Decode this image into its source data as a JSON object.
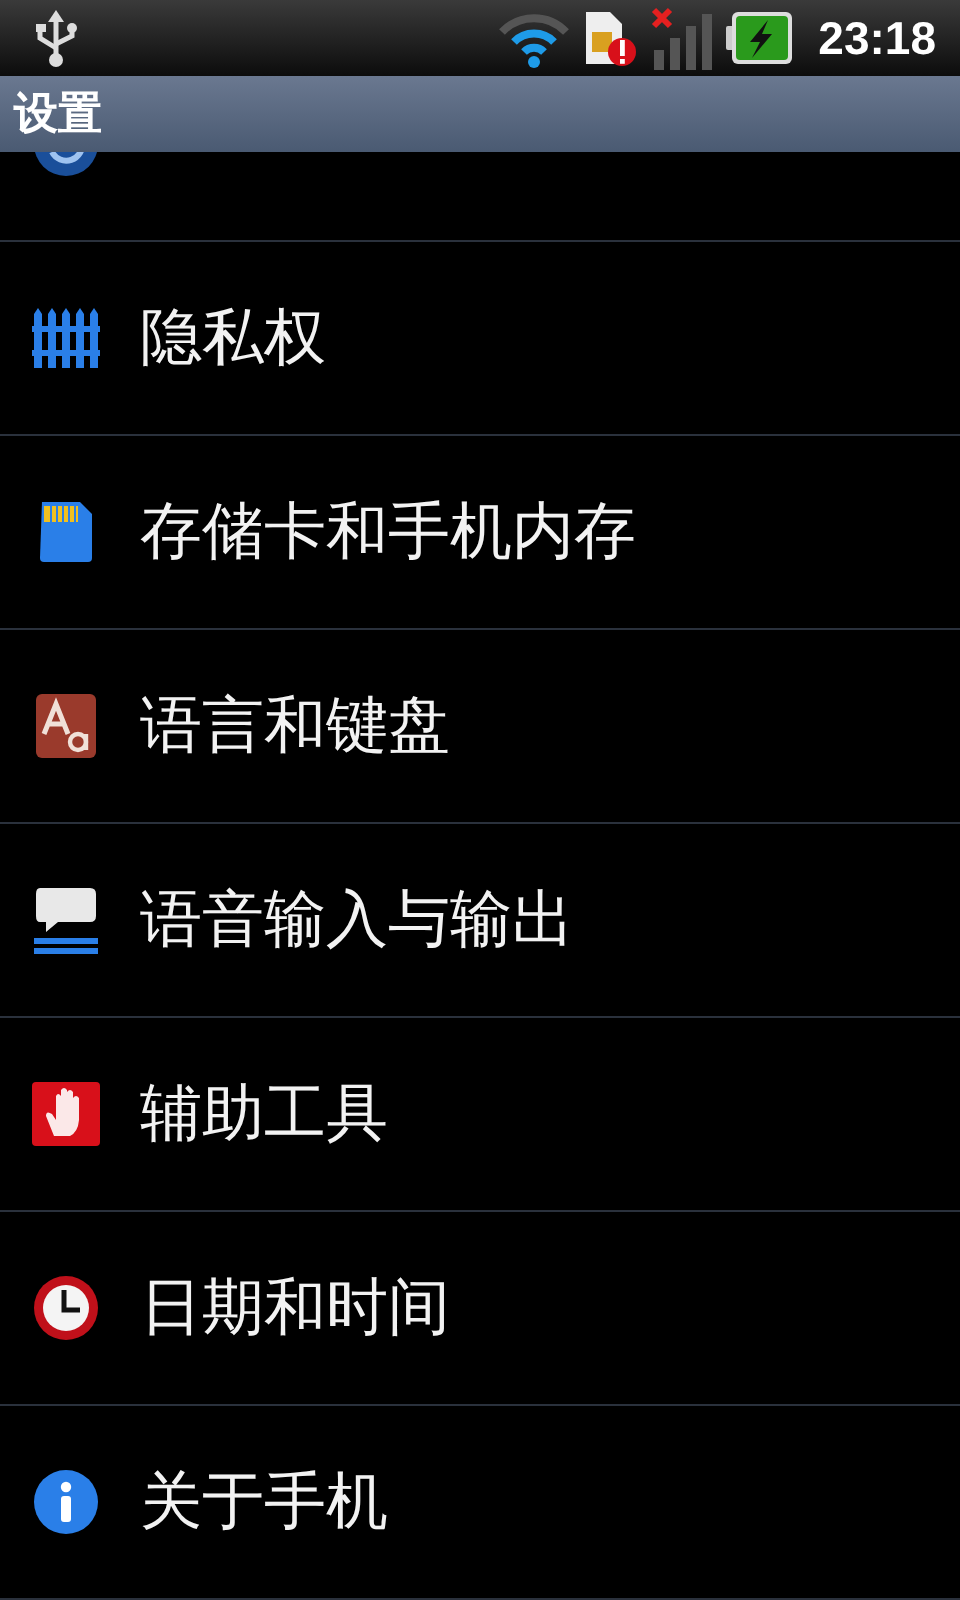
{
  "status_bar": {
    "time": "23:18"
  },
  "title_bar": {
    "title": "设置"
  },
  "settings": [
    {
      "label": "隐私权"
    },
    {
      "label": "存储卡和手机内存"
    },
    {
      "label": "语言和键盘"
    },
    {
      "label": "语音输入与输出"
    },
    {
      "label": "辅助工具"
    },
    {
      "label": "日期和时间"
    },
    {
      "label": "关于手机"
    }
  ]
}
